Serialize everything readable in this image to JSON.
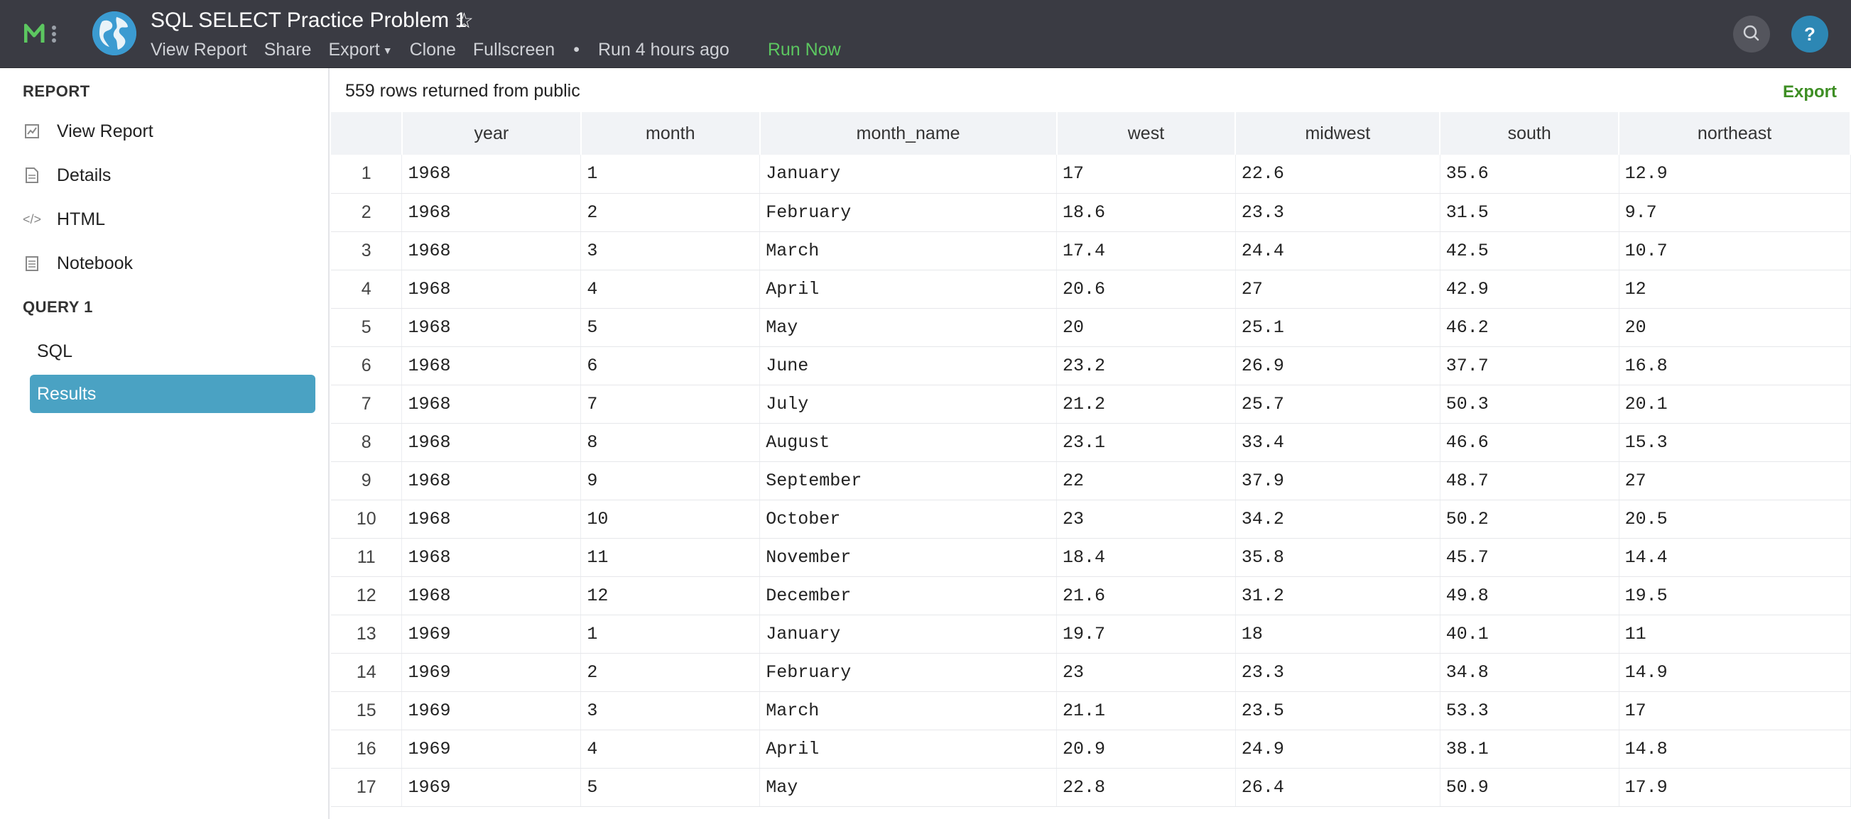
{
  "header": {
    "title": "SQL SELECT Practice Problem 1",
    "nav": {
      "view_report": "View Report",
      "share": "Share",
      "export": "Export",
      "clone": "Clone",
      "fullscreen": "Fullscreen",
      "bullet": "•",
      "run_status": "Run 4 hours ago",
      "run_now": "Run Now"
    },
    "help_label": "?",
    "colors": {
      "bar": "#3a3b43",
      "run_now": "#5cc760",
      "help": "#2d87b4"
    }
  },
  "sidebar": {
    "report_section": "REPORT",
    "report_items": [
      {
        "label": "View Report",
        "icon": "chart-icon"
      },
      {
        "label": "Details",
        "icon": "document-icon"
      },
      {
        "label": "HTML",
        "icon": "code-icon"
      },
      {
        "label": "Notebook",
        "icon": "notebook-icon"
      }
    ],
    "query_section": "QUERY 1",
    "query_items": [
      {
        "label": "SQL",
        "active": false
      },
      {
        "label": "Results",
        "active": true
      }
    ],
    "active_color": "#4aa2c3"
  },
  "results": {
    "summary": "559 rows returned from public",
    "export_label": "Export",
    "columns": [
      "year",
      "month",
      "month_name",
      "west",
      "midwest",
      "south",
      "northeast"
    ],
    "rows": [
      [
        "1",
        "1968",
        "1",
        "January",
        "17",
        "22.6",
        "35.6",
        "12.9"
      ],
      [
        "2",
        "1968",
        "2",
        "February",
        "18.6",
        "23.3",
        "31.5",
        "9.7"
      ],
      [
        "3",
        "1968",
        "3",
        "March",
        "17.4",
        "24.4",
        "42.5",
        "10.7"
      ],
      [
        "4",
        "1968",
        "4",
        "April",
        "20.6",
        "27",
        "42.9",
        "12"
      ],
      [
        "5",
        "1968",
        "5",
        "May",
        "20",
        "25.1",
        "46.2",
        "20"
      ],
      [
        "6",
        "1968",
        "6",
        "June",
        "23.2",
        "26.9",
        "37.7",
        "16.8"
      ],
      [
        "7",
        "1968",
        "7",
        "July",
        "21.2",
        "25.7",
        "50.3",
        "20.1"
      ],
      [
        "8",
        "1968",
        "8",
        "August",
        "23.1",
        "33.4",
        "46.6",
        "15.3"
      ],
      [
        "9",
        "1968",
        "9",
        "September",
        "22",
        "37.9",
        "48.7",
        "27"
      ],
      [
        "10",
        "1968",
        "10",
        "October",
        "23",
        "34.2",
        "50.2",
        "20.5"
      ],
      [
        "11",
        "1968",
        "11",
        "November",
        "18.4",
        "35.8",
        "45.7",
        "14.4"
      ],
      [
        "12",
        "1968",
        "12",
        "December",
        "21.6",
        "31.2",
        "49.8",
        "19.5"
      ],
      [
        "13",
        "1969",
        "1",
        "January",
        "19.7",
        "18",
        "40.1",
        "11"
      ],
      [
        "14",
        "1969",
        "2",
        "February",
        "23",
        "23.3",
        "34.8",
        "14.9"
      ],
      [
        "15",
        "1969",
        "3",
        "March",
        "21.1",
        "23.5",
        "53.3",
        "17"
      ],
      [
        "16",
        "1969",
        "4",
        "April",
        "20.9",
        "24.9",
        "38.1",
        "14.8"
      ],
      [
        "17",
        "1969",
        "5",
        "May",
        "22.8",
        "26.4",
        "50.9",
        "17.9"
      ]
    ]
  }
}
